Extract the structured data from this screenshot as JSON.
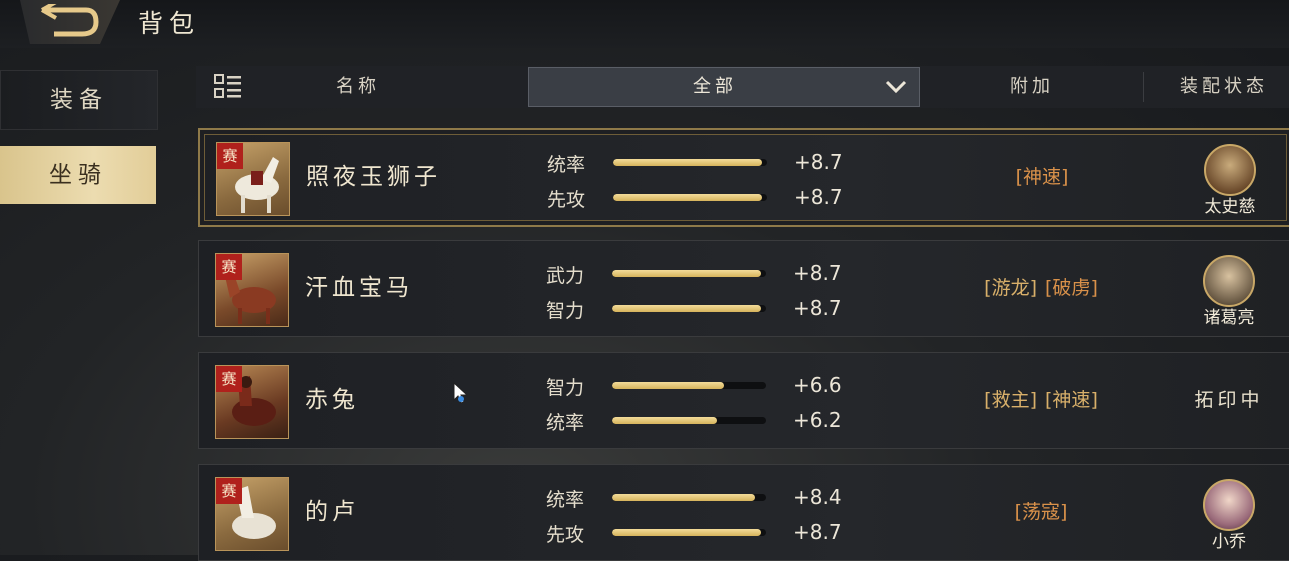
{
  "header": {
    "title": "背包"
  },
  "sidebar": {
    "tabs": [
      {
        "label": "装备",
        "active": false
      },
      {
        "label": "坐骑",
        "active": true
      }
    ]
  },
  "table_header": {
    "name_col": "名称",
    "filter_value": "全部",
    "extra_col": "附加",
    "equip_col": "装配状态"
  },
  "mounts": [
    {
      "name": "照夜玉狮子",
      "tag": "赛",
      "selected": true,
      "stats": [
        {
          "label": "统率",
          "value": "+8.7",
          "fill": 0.97
        },
        {
          "label": "先攻",
          "value": "+8.7",
          "fill": 0.97
        }
      ],
      "skills": [
        "神速"
      ],
      "equipped_by": "太史慈",
      "status": ""
    },
    {
      "name": "汗血宝马",
      "tag": "赛",
      "selected": false,
      "stats": [
        {
          "label": "武力",
          "value": "+8.7",
          "fill": 0.97
        },
        {
          "label": "智力",
          "value": "+8.7",
          "fill": 0.97
        }
      ],
      "skills": [
        "游龙",
        "破虏"
      ],
      "equipped_by": "诸葛亮",
      "status": ""
    },
    {
      "name": "赤兔",
      "tag": "赛",
      "selected": false,
      "stats": [
        {
          "label": "智力",
          "value": "+6.6",
          "fill": 0.73
        },
        {
          "label": "统率",
          "value": "+6.2",
          "fill": 0.68
        }
      ],
      "skills": [
        "救主",
        "神速"
      ],
      "equipped_by": "",
      "status": "拓印中"
    },
    {
      "name": "的卢",
      "tag": "赛",
      "selected": false,
      "stats": [
        {
          "label": "统率",
          "value": "+8.4",
          "fill": 0.93
        },
        {
          "label": "先攻",
          "value": "+8.7",
          "fill": 0.97
        }
      ],
      "skills": [
        "荡寇"
      ],
      "equipped_by": "小乔",
      "status": ""
    }
  ],
  "colors": {
    "accent_gold": "#e2cd98",
    "skill_orange": "#d9914a",
    "tag_red": "#b0211c"
  }
}
